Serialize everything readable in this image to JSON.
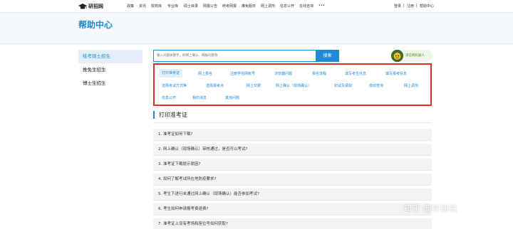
{
  "topnav": {
    "logo_text": "研招网",
    "items": [
      "政策",
      "资讯",
      "院校库",
      "专业库",
      "硕士目录",
      "网报公告",
      "统考网报",
      "推免服务",
      "网上调剂",
      "信息公开",
      "在线咨询",
      "•••"
    ],
    "right": [
      "登录",
      "|",
      "注册",
      "|",
      "帮助中心"
    ]
  },
  "page_title": "帮助中心",
  "sidebar": {
    "items": [
      {
        "label": "统考硕士招生",
        "active": true
      },
      {
        "label": "推免生招生",
        "active": false
      },
      {
        "label": "博士生招生",
        "active": false
      }
    ]
  },
  "search": {
    "placeholder": "输入问题关键字，如网上确认、网报问题等",
    "button_label": "搜索"
  },
  "robot": {
    "label": "求信网机器人"
  },
  "categories": [
    {
      "label": "打印准考证",
      "active": true
    },
    {
      "label": "网上报名",
      "active": false
    },
    {
      "label": "注册学信网账号",
      "active": false
    },
    {
      "label": "浏览器问题",
      "active": false
    },
    {
      "label": "报名流程",
      "active": false
    },
    {
      "label": "填写考生信息",
      "active": false
    },
    {
      "label": "填写报考信息",
      "active": false
    },
    {
      "label": "选择考试方式等",
      "active": false
    },
    {
      "label": "选择报考点",
      "active": false
    },
    {
      "label": "网上交费",
      "active": false
    },
    {
      "label": "网上确认（现场确认）",
      "active": false
    },
    {
      "label": "初试及录取",
      "active": false
    },
    {
      "label": "成绩查询",
      "active": false
    },
    {
      "label": "网上调剂",
      "active": false
    },
    {
      "label": "信息公开",
      "active": false
    },
    {
      "label": "我的消息",
      "active": false
    },
    {
      "label": "其他问题",
      "active": false
    }
  ],
  "section": {
    "title": "打印准考证"
  },
  "faqs": [
    "1. 准考证如何下载?",
    "2. 网上确认（现场确认）审核通过，是否可以考试?",
    "3. 准考证下载提示原因?",
    "4. 如何了解考试所在地防疫要求?",
    "5. 考生下进行未通过网上确认（现场确认）能否参加考试?",
    "6. 考生如何申请报考费退费?",
    "7. 准考证上没有考场和座位号如何获取?"
  ],
  "watermark": "知乎 @许加右",
  "colors": {
    "accent": "#1f8ad6",
    "highlight_border": "#e0302a"
  }
}
